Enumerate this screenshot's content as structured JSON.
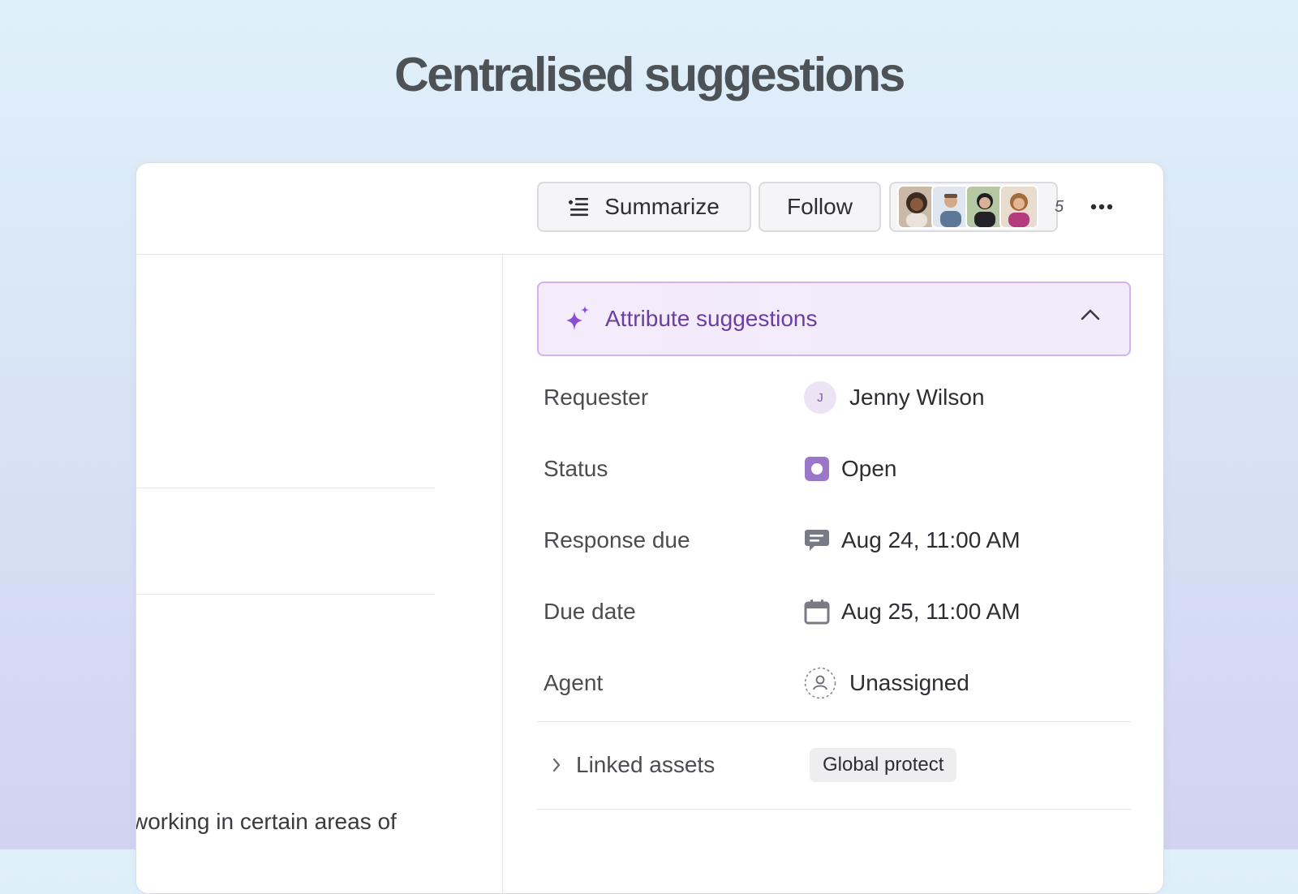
{
  "hero": {
    "title": "Centralised suggestions"
  },
  "toolbar": {
    "summarize_label": "Summarize",
    "summarize_icon": "list-summarize-icon",
    "follow_label": "Follow",
    "followers_count": "5",
    "more_icon": "more-horizontal-icon"
  },
  "panel": {
    "suggestions_label": "Attribute suggestions",
    "suggestions_icon": "sparkle-icon",
    "suggestions_accent": "#6b3fa0",
    "fields": {
      "requester": {
        "label": "Requester",
        "initial": "J",
        "value": "Jenny Wilson"
      },
      "status": {
        "label": "Status",
        "value": "Open",
        "color": "#9b77c9"
      },
      "response_due": {
        "label": "Response due",
        "value": "Aug 24, 11:00 AM"
      },
      "due_date": {
        "label": "Due date",
        "value": "Aug 25, 11:00 AM"
      },
      "agent": {
        "label": "Agent",
        "value": "Unassigned"
      }
    },
    "linked_assets": {
      "label": "Linked assets",
      "tag": "Global protect"
    }
  },
  "left": {
    "snippet": "working in certain areas of"
  }
}
